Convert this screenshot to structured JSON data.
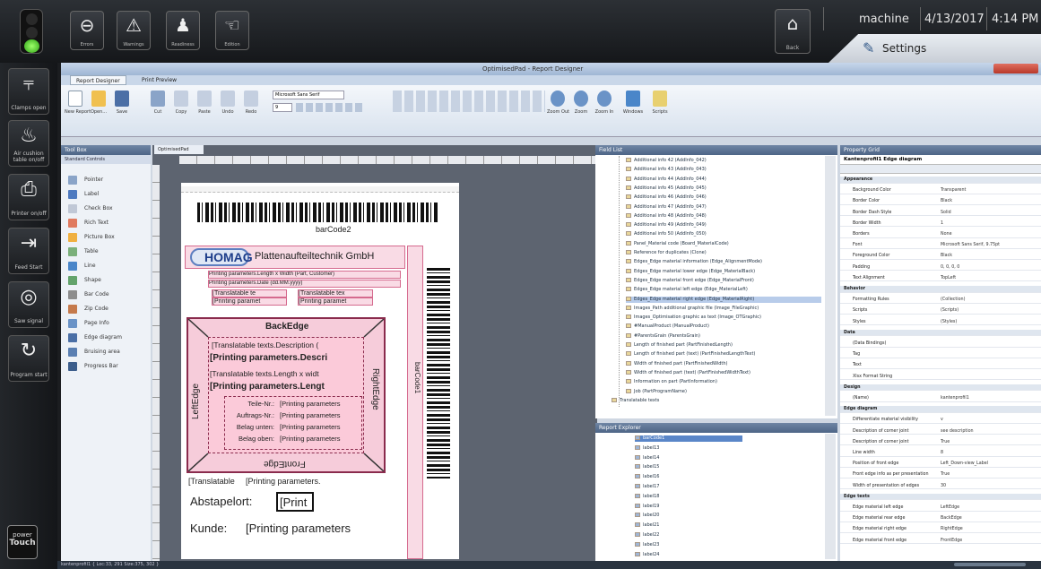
{
  "topbar": {
    "buttons": [
      {
        "label": "Errors",
        "icon": "stop-icon"
      },
      {
        "label": "Warnings",
        "icon": "warning-icon"
      },
      {
        "label": "Readiness",
        "icon": "worker-icon"
      },
      {
        "label": "Edition",
        "icon": "hand-icon"
      }
    ],
    "back_label": "Back",
    "user": "machine",
    "date": "4/13/2017",
    "time": "4:14 PM",
    "settings_tab": "Settings"
  },
  "leftbar": [
    {
      "label": "Clamps open",
      "icon": "clamp-icon"
    },
    {
      "label": "Air cushion table on/off",
      "icon": "air-table-icon"
    },
    {
      "label": "Printer on/off",
      "icon": "printer-icon"
    },
    {
      "label": "Feed Start",
      "icon": "feed-icon"
    },
    {
      "label": "Saw signal",
      "icon": "saw-icon"
    },
    {
      "label": "Program start",
      "icon": "program-icon"
    }
  ],
  "power_touch": {
    "line1": "power",
    "line2": "Touch"
  },
  "app": {
    "title": "OptimisedPad - Report Designer",
    "ribbon_tabs": [
      "Report Designer",
      "Print Preview"
    ],
    "ribbon_buttons": [
      "New Report",
      "Open...",
      "Save",
      "Cut",
      "Copy",
      "Paste",
      "Undo",
      "Redo",
      "Zoom Out",
      "Zoom",
      "Zoom In",
      "Windows",
      "Scripts"
    ],
    "font_name": "Microsoft Sans Serif",
    "font_size": "9",
    "toolbox_title": "Tool Box",
    "toolbox_section": "Standard Controls",
    "toolbox_items": [
      "Pointer",
      "Label",
      "Check Box",
      "Rich Text",
      "Picture Box",
      "Table",
      "Line",
      "Shape",
      "Bar Code",
      "Zip Code",
      "Page Info",
      "Edge diagram",
      "Bruising area",
      "Progress Bar"
    ],
    "doc_tab": "OptimisedPad",
    "fieldlist_title": "Field List",
    "report_explorer_title": "Report Explorer",
    "properties_title": "Property Grid",
    "properties_object": "Kantenprofil1  Edge diagram",
    "status": "kantenprofil1  {  Loc:33, 291  Size:375, 302  }"
  },
  "report": {
    "barcode_label": "barCode2",
    "barcode_vertical_label": "barCode1",
    "logo_text": "HOMAG",
    "company_text": "Plattenaufteiltechnik GmbH",
    "printing_line1": "Printing parameters.Length x Width (Part, Customer)",
    "printing_line2": "Printing parameters.Date (dd.MM.yyyy)",
    "translatable_short_a": "[Translatable te",
    "printing_short_a": "[Printing paramet",
    "translatable_short_b": "[Translatable tex",
    "printing_short_b": "[Printing paramet",
    "back_edge": "BackEdge",
    "front_edge": "FrontEdge",
    "left_edge": "LeftEdge",
    "right_edge": "RightEdge",
    "desc_translatable": "[Translatable texts.Description (",
    "desc_printing": "[Printing parameters.Descri",
    "length_translatable": "[Translatable texts.Length x widt",
    "length_printing": "[Printing parameters.Lengt",
    "rows": [
      {
        "label": "Teile-Nr.:",
        "value": "[Printing parameters"
      },
      {
        "label": "Auftrags-Nr.:",
        "value": "[Printing parameters"
      },
      {
        "label": "Belag unten:",
        "value": "[Printing parameters"
      },
      {
        "label": "Belag oben:",
        "value": "[Printing parameters"
      }
    ],
    "bottom_translatable": "[Translatable",
    "bottom_printing": "[Printing parameters.",
    "abstapel_label": "Abstapelort:",
    "abstapel_value": "[Print",
    "kunde_label": "Kunde:",
    "kunde_value": "[Printing parameters"
  },
  "fieldlist": [
    "Additional info 42 (AddInfo_042)",
    "Additional info 43 (AddInfo_043)",
    "Additional info 44 (AddInfo_044)",
    "Additional info 45 (AddInfo_045)",
    "Additional info 46 (AddInfo_046)",
    "Additional info 47 (AddInfo_047)",
    "Additional info 48 (AddInfo_048)",
    "Additional info 49 (AddInfo_049)",
    "Additional info 50 (AddInfo_050)",
    "Panel_Material code (Board_MaterialCode)",
    "Reference for duplicates (Clone)",
    "Edges_Edge material information (Edge_AlignmentMode)",
    "Edges_Edge material lower edge (Edge_MaterialBack)",
    "Edges_Edge material front edge (Edge_MaterialFront)",
    "Edges_Edge material left edge (Edge_MaterialLeft)",
    "Edges_Edge material right edge (Edge_MaterialRight)",
    "Images_Path additional graphic file (Image_FileGraphic)",
    "Images_Optimisation graphic as text (Image_OTGraphic)",
    "#ManualProduct (ManualProduct)",
    "#ParentsGrain (ParentsGrain)",
    "Length of finished part (PartFinishedLength)",
    "Length of finished part (text) (PartFinishedLengthText)",
    "Width of finished part (PartFinishedWidth)",
    "Width of finished part (text) (PartFinishedWidthText)",
    "Information on part (PartInformation)",
    "Job (PartProgramName)",
    "Translatable texts"
  ],
  "report_explorer": [
    "barCode1",
    "label13",
    "label14",
    "label15",
    "label16",
    "label17",
    "label18",
    "label19",
    "label20",
    "label21",
    "label22",
    "label23",
    "label24"
  ],
  "properties": [
    {
      "cat": true,
      "k": "Appearance",
      "v": ""
    },
    {
      "k": "Background Color",
      "v": "Transparent"
    },
    {
      "k": "Border Color",
      "v": "Black"
    },
    {
      "k": "Border Dash Style",
      "v": "Solid"
    },
    {
      "k": "Border Width",
      "v": "1"
    },
    {
      "k": "Borders",
      "v": "None"
    },
    {
      "k": "Font",
      "v": "Microsoft Sans Serif, 9.75pt"
    },
    {
      "k": "Foreground Color",
      "v": "Black"
    },
    {
      "k": "Padding",
      "v": "0, 0, 0, 0"
    },
    {
      "k": "Text Alignment",
      "v": "TopLeft"
    },
    {
      "cat": true,
      "k": "Behavior",
      "v": ""
    },
    {
      "k": "Formatting Rules",
      "v": "(Collection)"
    },
    {
      "k": "Scripts",
      "v": "(Scripts)"
    },
    {
      "k": "Styles",
      "v": "(Styles)"
    },
    {
      "cat": true,
      "k": "Data",
      "v": ""
    },
    {
      "k": "(Data Bindings)",
      "v": ""
    },
    {
      "k": "Tag",
      "v": ""
    },
    {
      "k": "Text",
      "v": ""
    },
    {
      "k": "Xlsx Format String",
      "v": ""
    },
    {
      "cat": true,
      "k": "Design",
      "v": ""
    },
    {
      "k": "(Name)",
      "v": "kantenprofil1"
    },
    {
      "cat": true,
      "k": "Edge diagram",
      "v": ""
    },
    {
      "k": "Differentiate material visibility",
      "v": "v"
    },
    {
      "k": "Description of corner joint",
      "v": "see description"
    },
    {
      "k": "Description of corner joint",
      "v": "True"
    },
    {
      "k": "Line width",
      "v": "8"
    },
    {
      "k": "Position of front edge",
      "v": "Left_Down-view_Label"
    },
    {
      "k": "Front edge info as per presentation",
      "v": "True"
    },
    {
      "k": "Width of presentation of edges",
      "v": "30"
    },
    {
      "cat": true,
      "k": "Edge texts",
      "v": ""
    },
    {
      "k": "Edge material left edge",
      "v": "LeftEdge"
    },
    {
      "k": "Edge material rear edge",
      "v": "BackEdge"
    },
    {
      "k": "Edge material right edge",
      "v": "RightEdge"
    },
    {
      "k": "Edge material front edge",
      "v": "FrontEdge"
    }
  ]
}
